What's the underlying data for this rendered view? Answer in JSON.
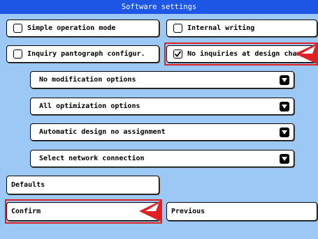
{
  "window": {
    "title": "Software settings"
  },
  "options": {
    "simple_operation_mode": {
      "label": "Simple operation mode",
      "checked": false
    },
    "internal_writing": {
      "label": "Internal writing",
      "checked": false
    },
    "inquiry_pantograph": {
      "label": "Inquiry pantograph configur.",
      "checked": false
    },
    "no_inquiries_design_change": {
      "label": "No inquiries at design change",
      "checked": true
    }
  },
  "dropdowns": {
    "modification": "No modification options",
    "optimization": "All optimization options",
    "design_assignment": "Automatic design no assignment",
    "network": "Select network connection"
  },
  "buttons": {
    "defaults": "Defaults",
    "confirm": "Confirm",
    "previous": "Previous"
  },
  "colors": {
    "background": "#9CC8F6",
    "titlebar": "#1E57E6",
    "highlight": "#E02025"
  }
}
